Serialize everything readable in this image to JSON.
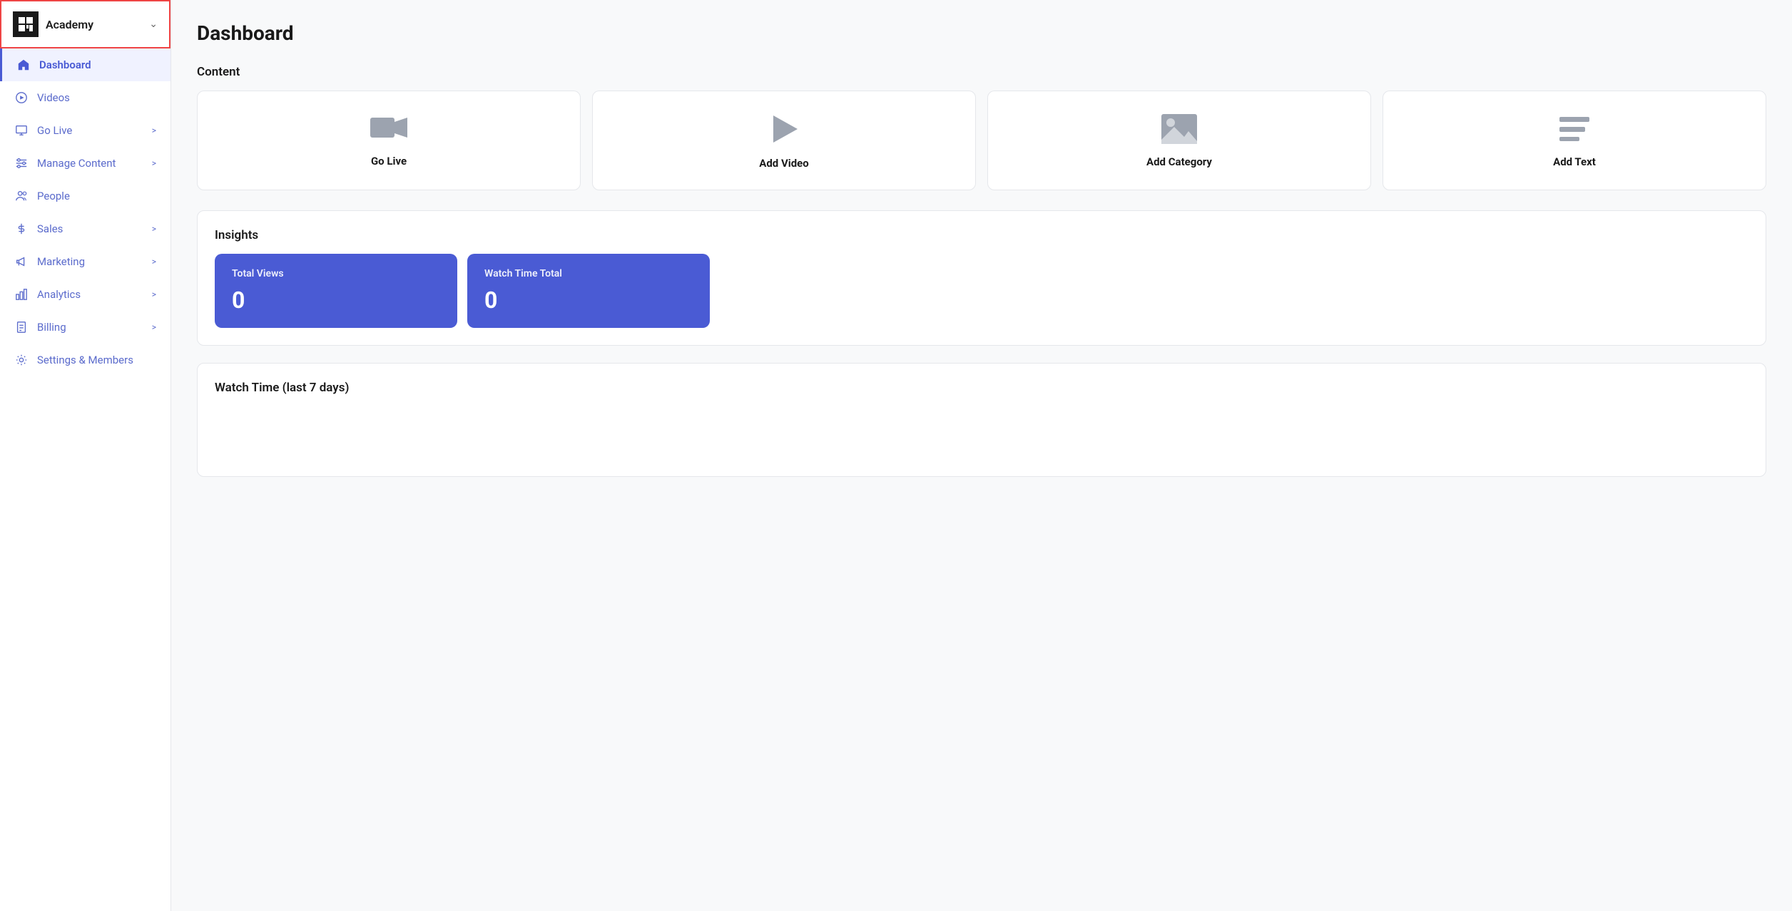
{
  "sidebar": {
    "logo": {
      "text": "Academy",
      "chevron": "∨"
    },
    "items": [
      {
        "id": "dashboard",
        "label": "Dashboard",
        "icon": "home",
        "active": true,
        "hasChevron": false
      },
      {
        "id": "videos",
        "label": "Videos",
        "icon": "play-circle",
        "active": false,
        "hasChevron": false
      },
      {
        "id": "go-live",
        "label": "Go Live",
        "icon": "monitor",
        "active": false,
        "hasChevron": true
      },
      {
        "id": "manage-content",
        "label": "Manage Content",
        "icon": "sliders",
        "active": false,
        "hasChevron": true
      },
      {
        "id": "people",
        "label": "People",
        "icon": "users",
        "active": false,
        "hasChevron": false
      },
      {
        "id": "sales",
        "label": "Sales",
        "icon": "dollar",
        "active": false,
        "hasChevron": true
      },
      {
        "id": "marketing",
        "label": "Marketing",
        "icon": "megaphone",
        "active": false,
        "hasChevron": true
      },
      {
        "id": "analytics",
        "label": "Analytics",
        "icon": "bar-chart",
        "active": false,
        "hasChevron": true
      },
      {
        "id": "billing",
        "label": "Billing",
        "icon": "file-text",
        "active": false,
        "hasChevron": true
      },
      {
        "id": "settings",
        "label": "Settings & Members",
        "icon": "gear",
        "active": false,
        "hasChevron": false
      }
    ]
  },
  "main": {
    "page_title": "Dashboard",
    "content_section": {
      "title": "Content",
      "cards": [
        {
          "id": "go-live",
          "label": "Go Live",
          "icon": "video-camera"
        },
        {
          "id": "add-video",
          "label": "Add Video",
          "icon": "play-triangle"
        },
        {
          "id": "add-category",
          "label": "Add Category",
          "icon": "image"
        },
        {
          "id": "add-text",
          "label": "Add Text",
          "icon": "text-lines"
        }
      ]
    },
    "insights_section": {
      "title": "Insights",
      "cards": [
        {
          "id": "total-views",
          "label": "Total Views",
          "value": "0"
        },
        {
          "id": "watch-time-total",
          "label": "Watch Time Total",
          "value": "0"
        }
      ]
    },
    "watch_time_section": {
      "title": "Watch Time (last 7 days)"
    }
  }
}
